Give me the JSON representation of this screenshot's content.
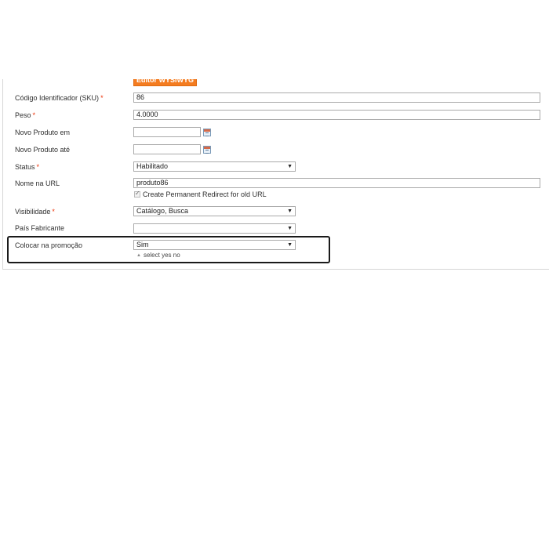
{
  "toolbar": {
    "wysiwyg_label": "Editor WYSIWYG"
  },
  "form": {
    "sku": {
      "label": "Código Identificador (SKU)",
      "required": "*",
      "value": "86"
    },
    "weight": {
      "label": "Peso",
      "required": "*",
      "value": "4.0000"
    },
    "new_from": {
      "label": "Novo Produto em",
      "value": ""
    },
    "new_to": {
      "label": "Novo Produto até",
      "value": ""
    },
    "status": {
      "label": "Status",
      "required": "*",
      "value": "Habilitado"
    },
    "url_key": {
      "label": "Nome na URL",
      "value": "produto86",
      "redirect_label": "Create Permanent Redirect for old URL",
      "redirect_checked": true
    },
    "visibility": {
      "label": "Visibilidade",
      "required": "*",
      "value": "Catálogo, Busca"
    },
    "country": {
      "label": "País Fabricante",
      "value": ""
    },
    "promotion": {
      "label": "Colocar na promoção",
      "value": "Sim",
      "note": "select yes no"
    }
  },
  "colors": {
    "accent": "#f47c20",
    "required": "#eb340a",
    "highlight_border": "#1a1a1a"
  },
  "icons": {
    "calendar": "calendar-icon",
    "select_arrow": "chevron-down-icon",
    "note_marker": "triangle-up-icon"
  }
}
